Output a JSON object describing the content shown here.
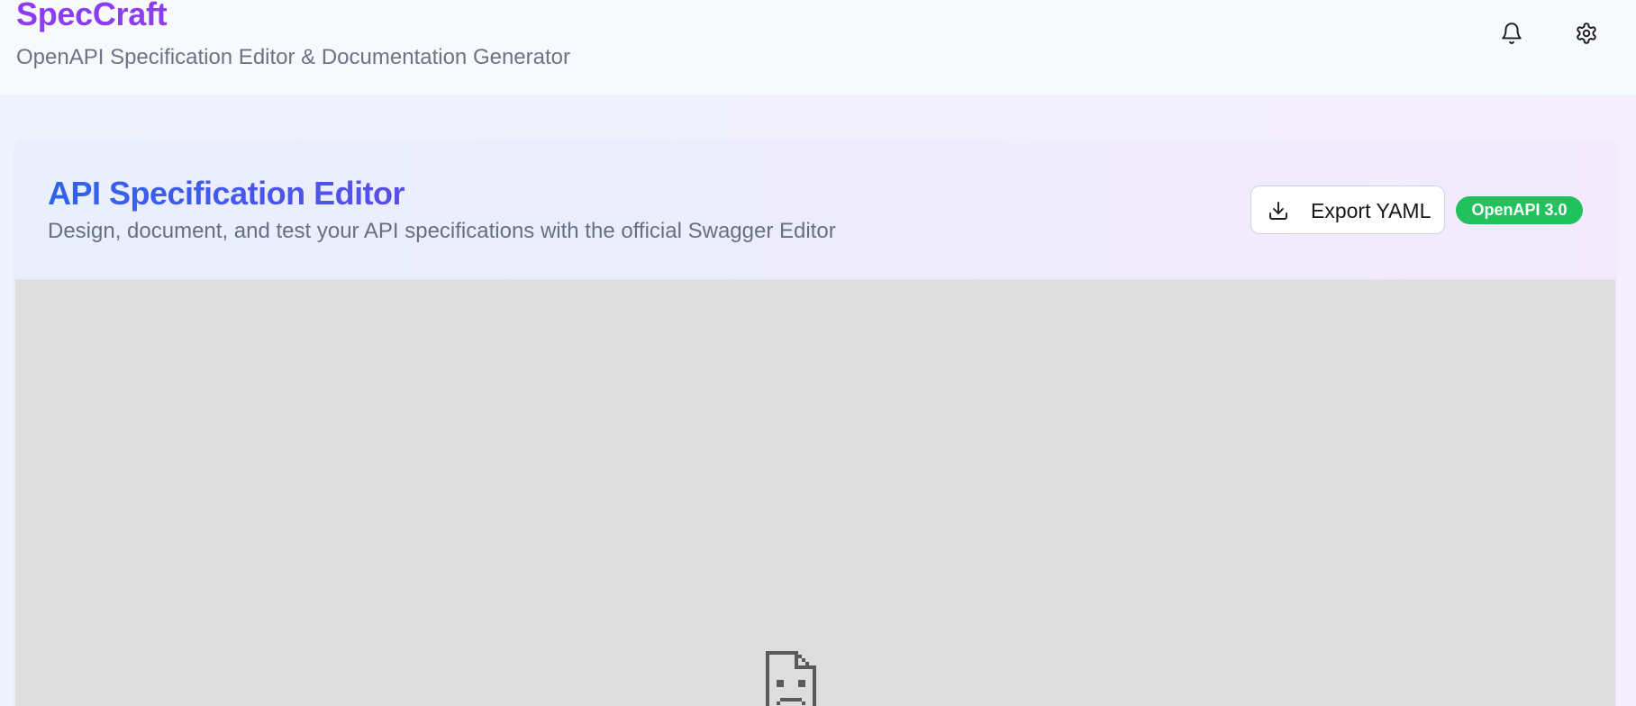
{
  "app": {
    "title": "SpecCraft",
    "subtitle": "OpenAPI Specification Editor & Documentation Generator",
    "brand_color": "#8b3ef0"
  },
  "header_actions": {
    "notifications_icon": "bell-icon",
    "settings_icon": "gear-icon"
  },
  "card": {
    "title": "API Specification Editor",
    "subtitle": "Design, document, and test your API specifications with the official Swagger Editor",
    "export_button": {
      "label": "Export YAML",
      "icon": "download-icon"
    },
    "version_badge": {
      "label": "OpenAPI 3.0",
      "color": "#22c15e"
    }
  },
  "editor_frame": {
    "state_icon": "sad-file-icon",
    "background": "#dddddd"
  },
  "colors": {
    "accent_blue": "#2f63ec",
    "muted_text": "#667085"
  }
}
